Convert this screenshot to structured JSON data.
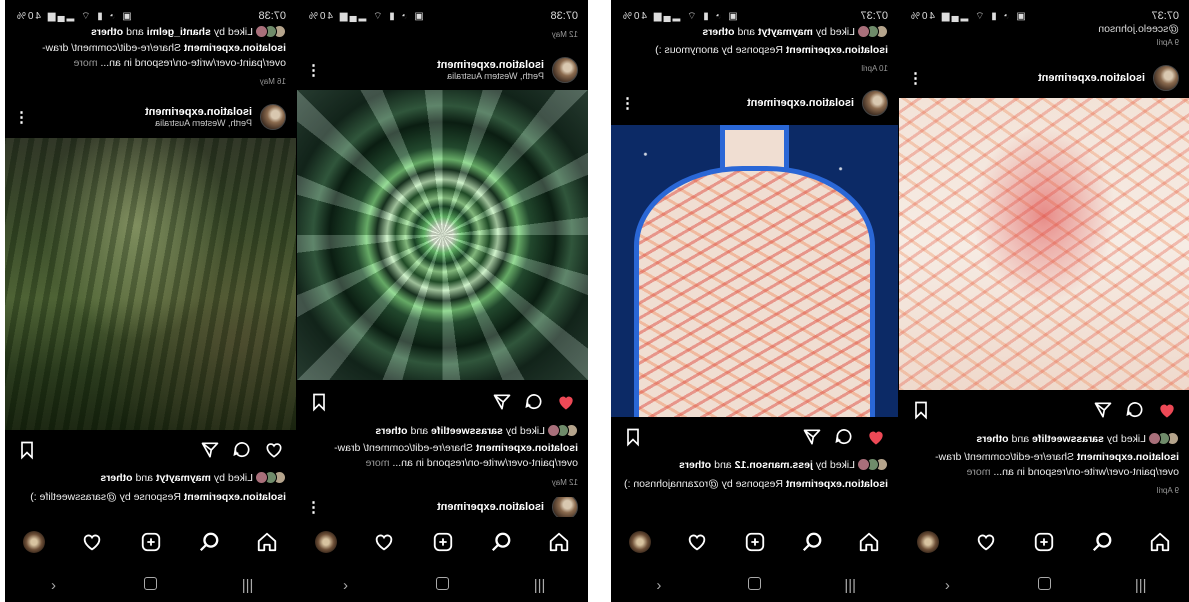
{
  "screens": [
    {
      "status": {
        "time": "07:38",
        "battery": "40%"
      },
      "top_date": "12 May",
      "post": {
        "username": "isolation.experiment",
        "location": "Perth, Western Australia"
      },
      "likes": {
        "prefix": "Liked by",
        "user": "sarassweetlife",
        "suffix": "and",
        "others": "others"
      },
      "caption": {
        "user": "isolation.experiment",
        "text": "Share/re-edit/comment/ draw-over/paint-over/write-on/respond in an...",
        "more": "more"
      },
      "date": "12 May",
      "next_username": "isolation.experiment"
    },
    {
      "status": {
        "time": "07:38",
        "battery": "40%"
      },
      "top_likes": {
        "prefix": "Liked by",
        "user": "shanti_gelmi",
        "suffix": "and",
        "others": "others"
      },
      "top_caption": {
        "user": "isolation.experiment",
        "text": "Share/re-edit/comment/ draw-over/paint-over/write-on/respond in an...",
        "more": "more"
      },
      "top_date": "16 May",
      "post": {
        "username": "isolation.experiment",
        "location": "Perth, Western Australia"
      },
      "likes": {
        "prefix": "Liked by",
        "user": "maymaytyt",
        "suffix": "and",
        "others": "others"
      },
      "caption": {
        "user": "isolation.experiment",
        "text": "Response by @sarassweetlife :)"
      }
    },
    {
      "status": {
        "time": "07:37",
        "battery": "40%"
      },
      "top_text": "@sceelo.johnson",
      "top_date": "9 April",
      "post": {
        "username": "isolation.experiment"
      },
      "likes": {
        "prefix": "Liked by",
        "user": "sarassweetlife",
        "suffix": "and",
        "others": "others"
      },
      "caption": {
        "user": "isolation.experiment",
        "text": "Share/re-edit/comment/ draw-over/paint-over/write-on/respond in an...",
        "more": "more"
      },
      "date": "9 April"
    },
    {
      "status": {
        "time": "07:37",
        "battery": "40%"
      },
      "top_likes": {
        "prefix": "Liked by",
        "user": "maymaytyt",
        "suffix": "and",
        "others": "others"
      },
      "top_caption": {
        "user": "isolation.experiment",
        "text": "Response by anonymous :)"
      },
      "top_date": "10 April",
      "post": {
        "username": "isolation.experiment"
      },
      "likes": {
        "prefix": "Liked by",
        "user": "jess.manson.12",
        "suffix": "and",
        "others": "others"
      },
      "caption": {
        "user": "isolation.experiment",
        "text": "Response by @rozannajohnson :)"
      }
    }
  ],
  "colors": {
    "heart_red": "#ed4956",
    "background": "#000000",
    "text": "#ffffff"
  },
  "icons": [
    "heart-icon",
    "comment-icon",
    "share-icon",
    "bookmark-icon",
    "home-icon",
    "search-icon",
    "add-icon",
    "activity-icon",
    "recent-apps-icon",
    "home-button-icon",
    "back-icon"
  ]
}
